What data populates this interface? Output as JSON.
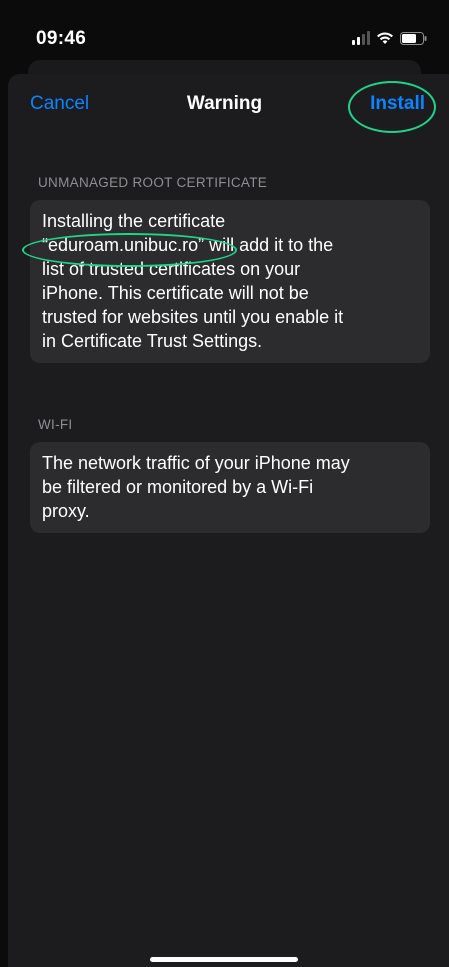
{
  "status_bar": {
    "time": "09:46"
  },
  "nav": {
    "cancel_label": "Cancel",
    "title": "Warning",
    "install_label": "Install"
  },
  "sections": {
    "root_cert": {
      "header": "UNMANAGED ROOT CERTIFICATE",
      "line1": "Installing the certificate",
      "line2": "“eduroam.unibuc.ro” will add it to the",
      "line3": "list of trusted certificates on your",
      "line4": "iPhone. This certificate will not be",
      "line5": "trusted for websites until you enable it",
      "line6": "in Certificate Trust Settings."
    },
    "wifi": {
      "header": "WI-FI",
      "line1": "The network traffic of your iPhone may",
      "line2": "be filtered or monitored by a Wi-Fi",
      "line3": "proxy."
    }
  },
  "colors": {
    "accent": "#0a84ff",
    "annotation": "#1fd38a",
    "card_background": "#2c2c2e",
    "sheet_background": "#1c1c1e"
  }
}
